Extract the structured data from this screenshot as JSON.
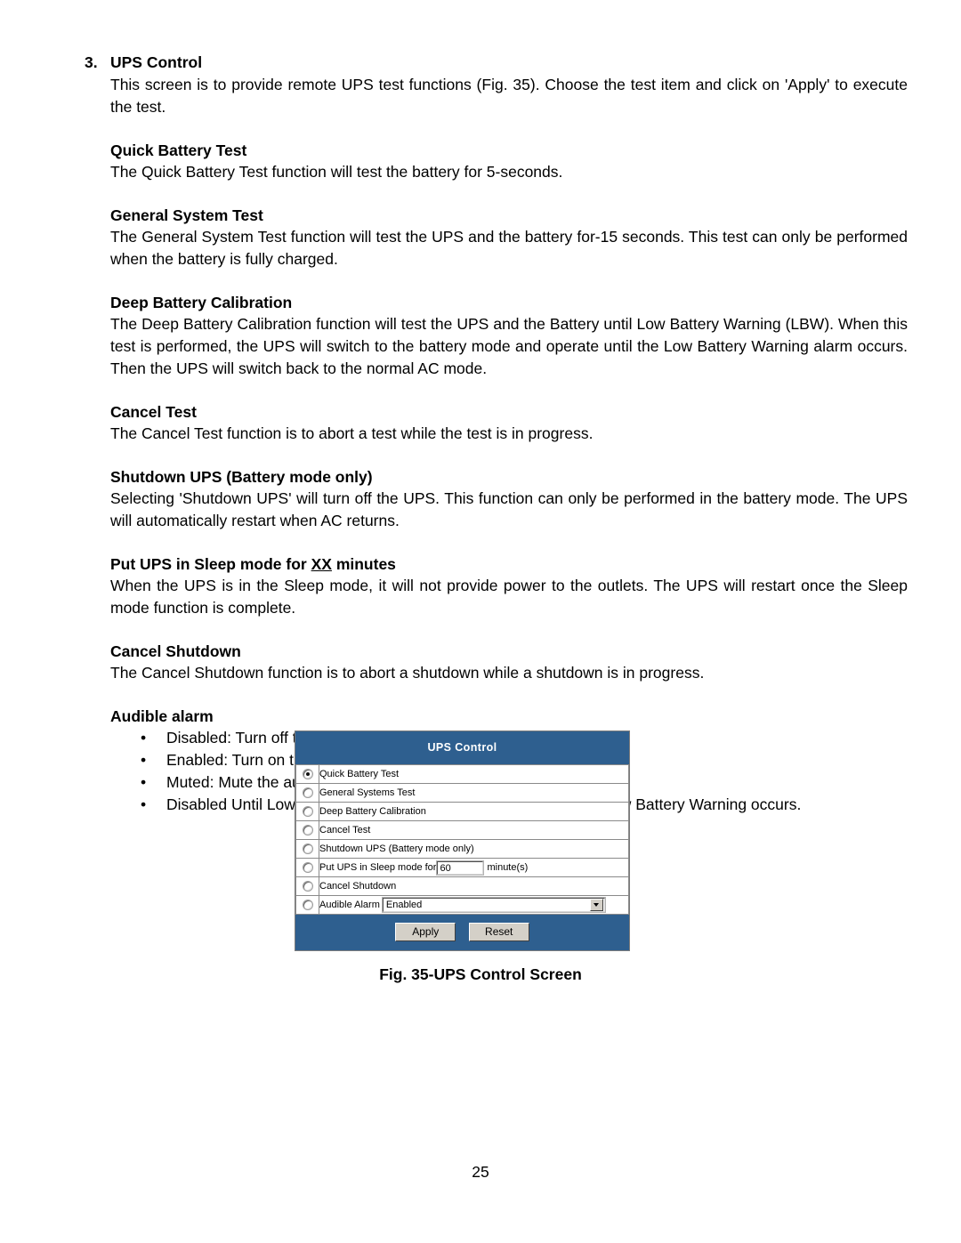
{
  "document": {
    "page_number": "25",
    "figure_caption": "Fig. 35-UPS Control Screen"
  },
  "sections": {
    "main": {
      "number": "3.",
      "title": "UPS Control",
      "intro": "This screen is to provide remote UPS test functions (Fig. 35).  Choose the test item and click on 'Apply' to execute the test."
    },
    "quick_battery_test": {
      "heading": "Quick Battery Test",
      "body": "The Quick Battery Test function will test the battery for 5-seconds."
    },
    "general_system_test": {
      "heading": "General System Test",
      "body": "The General System Test function will test the UPS and the battery for-15 seconds.  This test can only be performed when the battery is fully charged."
    },
    "deep_battery_calibration": {
      "heading": "Deep Battery Calibration",
      "body": "The Deep Battery Calibration function will test the UPS and the Battery until Low Battery Warning (LBW).  When this test is performed, the UPS will switch to the battery mode and operate until the Low Battery Warning alarm occurs.  Then the UPS will switch back to the normal AC mode."
    },
    "cancel_test": {
      "heading": "Cancel Test",
      "body": "The Cancel Test function is to abort a test while the test is in progress."
    },
    "shutdown_ups": {
      "heading": "Shutdown UPS (Battery mode only)",
      "body": "Selecting 'Shutdown UPS' will turn off the UPS.  This function can only be performed in the battery mode.  The UPS will automatically restart when AC returns."
    },
    "sleep_mode": {
      "heading_prefix": "Put UPS in Sleep mode for ",
      "heading_underlined": "XX",
      "heading_suffix": " minutes",
      "body": "When the UPS is in the Sleep mode, it will not provide power to the outlets.  The UPS will restart once the Sleep mode function is complete."
    },
    "cancel_shutdown": {
      "heading": "Cancel Shutdown",
      "body": "The Cancel Shutdown function is to abort a shutdown while a shutdown is in progress."
    },
    "audible_alarm": {
      "heading": "Audible alarm",
      "bullet_glyph": "•",
      "items": [
        "Disabled:  Turn off the audible alarm.",
        "Enabled:  Turn on the audible alarm.",
        "Muted:  Mute the audible alarm until an event occurs (Fault, LBW).",
        "Disabled Until Low Battery Warning:  Turn off the audible until a Low Battery Warning occurs."
      ]
    }
  },
  "ups_control_panel": {
    "title": "UPS Control",
    "header_color": "#2e5f8f",
    "rows": [
      {
        "label": "Quick Battery Test",
        "selected": true
      },
      {
        "label": "General Systems Test",
        "selected": false
      },
      {
        "label": "Deep Battery Calibration",
        "selected": false
      },
      {
        "label": "Cancel Test",
        "selected": false
      },
      {
        "label": "Shutdown UPS (Battery mode only)",
        "selected": false
      }
    ],
    "sleep_row": {
      "label_before": "Put UPS in Sleep mode for",
      "value": "60",
      "label_after": "minute(s)",
      "selected": false
    },
    "cancel_shutdown_row": {
      "label": "Cancel Shutdown",
      "selected": false
    },
    "audible_row": {
      "label": "Audible Alarm",
      "selected_option": "Enabled",
      "selected": false
    },
    "buttons": {
      "apply": "Apply",
      "reset": "Reset"
    }
  }
}
